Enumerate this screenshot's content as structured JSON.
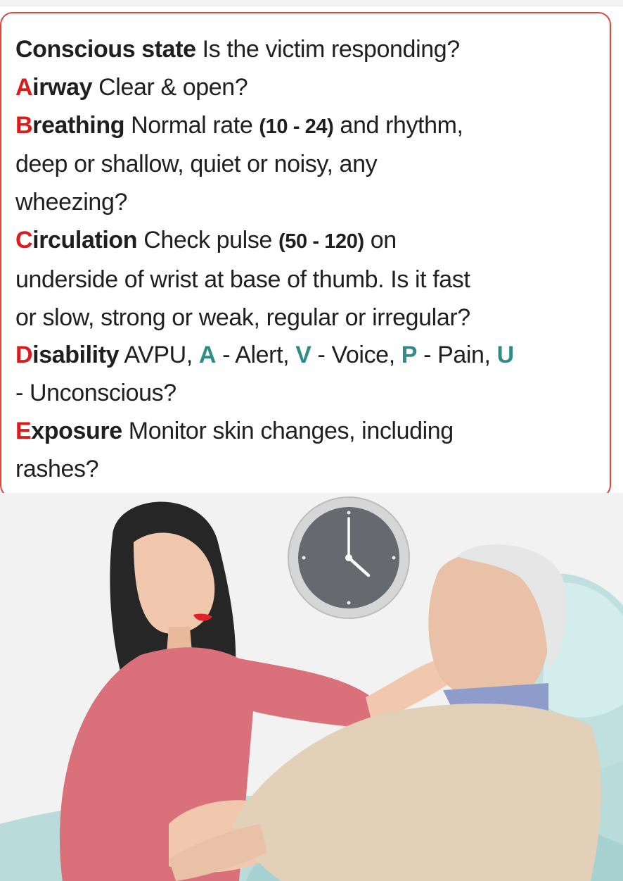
{
  "rows": [
    {
      "k": "Conscious state",
      "t": " Is the victim responding?"
    },
    {
      "k1": "A",
      "k2": "irway",
      "t": " Clear & open?"
    },
    {
      "k1": "B",
      "k2": "reathing",
      "t1": " Normal rate ",
      "n": "(10 - 24)",
      "t2": " and rhythm,"
    },
    {
      "t": "deep or shallow, quiet or noisy, any"
    },
    {
      "t": "wheezing?"
    },
    {
      "k1": "C",
      "k2": "irculation",
      "t1": " Check pulse ",
      "n": "(50 - 120)",
      "t2": " on"
    },
    {
      "t": "underside of wrist at base of thumb. Is it fast"
    },
    {
      "t": "or slow, strong or weak, regular or irregular?"
    },
    {
      "k1": "D",
      "k2": "isability",
      "t": " AVPU, ",
      "a": "A",
      "at": " - Alert, ",
      "v": "V",
      "vt": " - Voice, ",
      "p": "P",
      "pt": " - Pain, ",
      "u": "U"
    },
    {
      "t": "- Unconscious?"
    },
    {
      "k1": "E",
      "k2": "xposure",
      "t": " Monitor skin changes, including"
    },
    {
      "t": "rashes?"
    }
  ],
  "colors": {
    "accent_red": "#d91c1c",
    "accent_teal": "#2f8c86",
    "border": "#e0463c"
  },
  "illustration": {
    "icons": [
      "clock-icon",
      "caregiver",
      "patient",
      "hospital-bed"
    ]
  }
}
